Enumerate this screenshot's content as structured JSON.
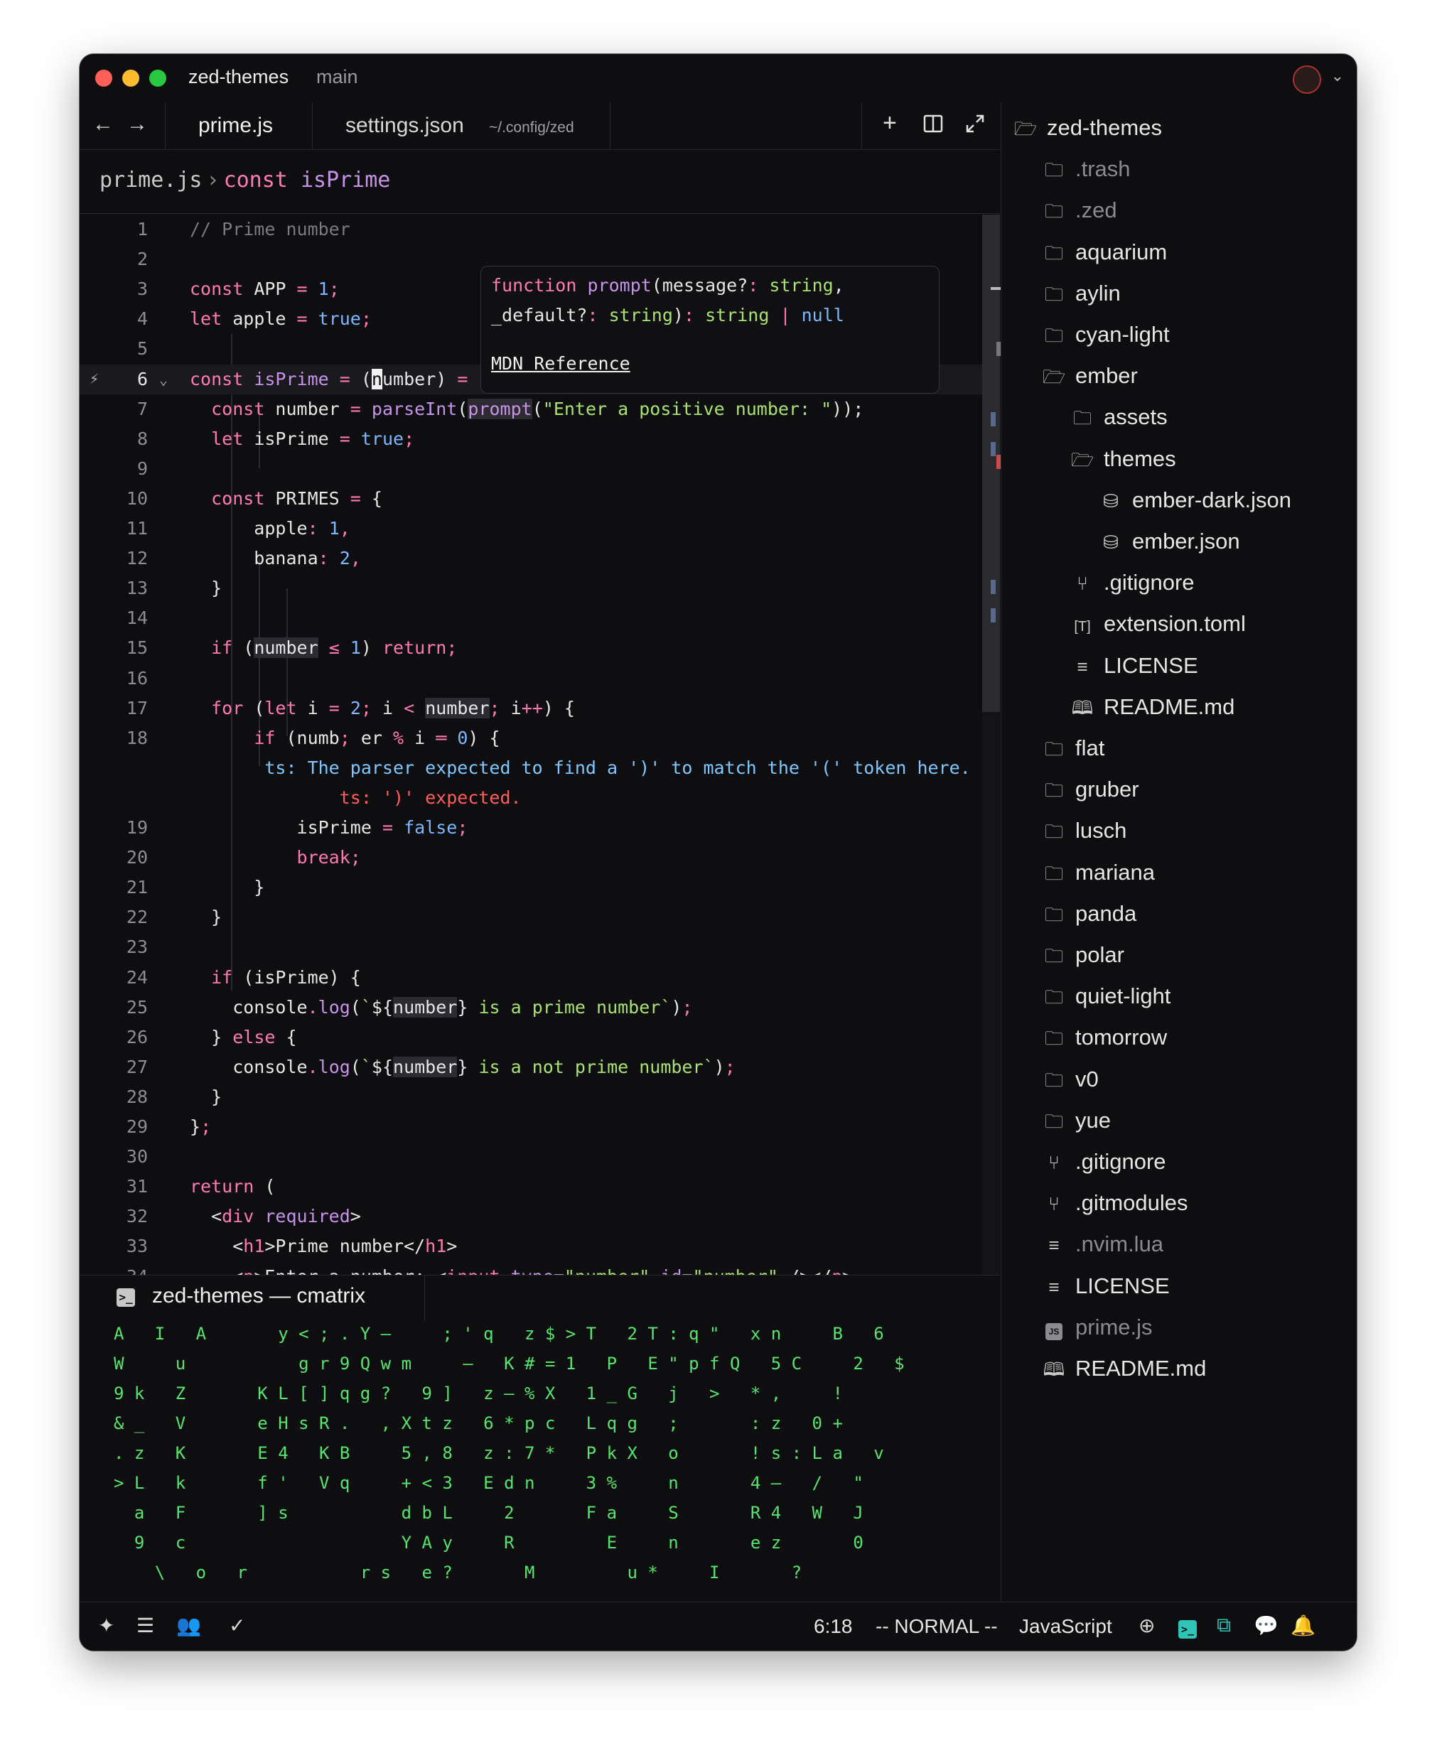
{
  "titlebar": {
    "project": "zed-themes",
    "branch": "main"
  },
  "tabs": {
    "active": "prime.js",
    "second": "settings.json",
    "second_path": "~/.config/zed"
  },
  "breadcrumb": {
    "file": "prime.js",
    "sep": "›",
    "symbol_kw": "const",
    "symbol": "isPrime"
  },
  "hover": {
    "line1": "function prompt(message?: string,",
    "line2": "_default?: string): string | null",
    "link": "MDN Reference"
  },
  "code_lines": [
    {
      "n": "1",
      "html": "<span class=\"c\">// Prime number</span>"
    },
    {
      "n": "2",
      "html": ""
    },
    {
      "n": "3",
      "html": "<span class=\"k\">const</span> APP <span class=\"o\">=</span> <span class=\"n\">1</span><span class=\"o\">;</span>"
    },
    {
      "n": "4",
      "html": "<span class=\"k\">let</span> apple <span class=\"o\">=</span> <span class=\"n\">true</span><span class=\"o\">;</span>"
    },
    {
      "n": "5",
      "html": ""
    },
    {
      "n": "6",
      "html": "<span class=\"k\">const</span> <span class=\"f\">isPrime</span> <span class=\"o\">=</span> (<span class=\"cursor\">n</span>umber) <span class=\"o\">=</span>"
    },
    {
      "n": "7",
      "html": "  <span class=\"k\">const</span> number <span class=\"o\">=</span> <span class=\"f\">parseInt</span>(<span class=\"f hl\">prompt</span>(<span class=\"s\">\"Enter a positive number: \"</span>));"
    },
    {
      "n": "8",
      "html": "  <span class=\"k\">let</span> isPrime <span class=\"o\">=</span> <span class=\"n\">true</span><span class=\"o\">;</span>"
    },
    {
      "n": "9",
      "html": ""
    },
    {
      "n": "10",
      "html": "  <span class=\"k\">const</span> PRIMES <span class=\"o\">=</span> {"
    },
    {
      "n": "11",
      "html": "      apple<span class=\"o\">:</span> <span class=\"n\">1</span><span class=\"o\">,</span>"
    },
    {
      "n": "12",
      "html": "      banana<span class=\"o\">:</span> <span class=\"n\">2</span><span class=\"o\">,</span>"
    },
    {
      "n": "13",
      "html": "  }"
    },
    {
      "n": "14",
      "html": ""
    },
    {
      "n": "15",
      "html": "  <span class=\"k\">if</span> (<span class=\"hl\">number</span> <span class=\"o\">≤</span> <span class=\"n\">1</span>) <span class=\"k\">return</span><span class=\"o\">;</span>"
    },
    {
      "n": "16",
      "html": ""
    },
    {
      "n": "17",
      "html": "  <span class=\"k\">for</span> (<span class=\"k\">let</span> i <span class=\"o\">=</span> <span class=\"n\">2</span><span class=\"o\">;</span> i <span class=\"o\">&lt;</span> <span class=\"hl\">number</span><span class=\"o\">;</span> i<span class=\"o\">++</span>) {"
    },
    {
      "n": "18",
      "html": "      <span class=\"k\">if</span> (numb<span class=\"o\">;</span> er <span class=\"o\">%</span> i <span class=\"o\">═</span> <span class=\"n\">0</span>) {"
    },
    {
      "n": "",
      "html": "       <span class=\"b\">ts: The parser expected to find a ')' to match the '(' token here.</span>"
    },
    {
      "n": "",
      "html": "              <span class=\"e\">ts: ')' expected.</span>"
    },
    {
      "n": "19",
      "html": "          isPrime <span class=\"o\">=</span> <span class=\"n\">false</span><span class=\"o\">;</span>"
    },
    {
      "n": "20",
      "html": "          <span class=\"k\">break</span><span class=\"o\">;</span>"
    },
    {
      "n": "21",
      "html": "      }"
    },
    {
      "n": "22",
      "html": "  }"
    },
    {
      "n": "23",
      "html": ""
    },
    {
      "n": "24",
      "html": "  <span class=\"k\">if</span> (isPrime) {"
    },
    {
      "n": "25",
      "html": "    console<span class=\"o\">.</span><span class=\"f\">log</span>(<span class=\"s\">`</span>${<span class=\"hl\">number</span>}<span class=\"s\"> is a prime number`</span>)<span class=\"o\">;</span>"
    },
    {
      "n": "26",
      "html": "  } <span class=\"k\">else</span> {"
    },
    {
      "n": "27",
      "html": "    console<span class=\"o\">.</span><span class=\"f\">log</span>(<span class=\"s\">`</span>${<span class=\"hl\">number</span>}<span class=\"s\"> is a not prime number`</span>)<span class=\"o\">;</span>"
    },
    {
      "n": "28",
      "html": "  }"
    },
    {
      "n": "29",
      "html": "}<span class=\"o\">;</span>"
    },
    {
      "n": "30",
      "html": ""
    },
    {
      "n": "31",
      "html": "<span class=\"k\">return</span> ("
    },
    {
      "n": "32",
      "html": "  &lt;<span class=\"k\">div</span> <span class=\"f\">required</span>&gt;"
    },
    {
      "n": "33",
      "html": "    &lt;<span class=\"k\">h1</span>&gt;Prime number&lt;/<span class=\"k\">h1</span>&gt;"
    },
    {
      "n": "34",
      "html": "    &lt;<span class=\"k\">p</span>&gt;Enter a number: &lt;<span class=\"k\">input</span> <span class=\"f\">type</span>=<span class=\"s\">\"number\"</span> <span class=\"f\">id</span>=<span class=\"s\">\"number\"</span> /&gt;&lt;/<span class=\"k\">p</span>&gt;"
    }
  ],
  "terminal": {
    "title": "zed-themes — cmatrix"
  },
  "matrix_lines": [
    "A   I   A       y < ; . Y –     ; ' q   z $ > T   2 T : q \"   x n     B   6",
    "W     u           g r 9 Q w m     –   K # = 1   P   E \" p f Q   5 C     2   $",
    "9 k   Z       K L [ ] q g ?   9 ]   z – % X   1 _ G   j   >   * ,     !",
    "& _   V       e H s R .   , X t z   6 * p c   L q g   ;       : z   0 +",
    ". z   K       E 4   K B     5 , 8   z : 7 *   P k X   o       ! s : L a   v",
    "> L   k       f '   V q     + < 3   E d n     3 %     n       4 –   /   \"",
    "  a   F       ] s           d b L     2       F a     S       R 4   W   J",
    "  9   c                     Y A y     R         E     n       e z       0",
    "    \\   o   r           r s   e ?       M         u *     I       ?"
  ],
  "tree": [
    {
      "label": "zed-themes",
      "icon": "folder-open-icon",
      "glyph": "🗁",
      "indent": 0,
      "dim": false
    },
    {
      "label": ".trash",
      "icon": "folder-icon",
      "glyph": "🗀",
      "indent": 1,
      "dim": true
    },
    {
      "label": ".zed",
      "icon": "folder-icon",
      "glyph": "🗀",
      "indent": 1,
      "dim": true
    },
    {
      "label": "aquarium",
      "icon": "folder-icon",
      "glyph": "🗀",
      "indent": 1,
      "dim": false
    },
    {
      "label": "aylin",
      "icon": "folder-icon",
      "glyph": "🗀",
      "indent": 1,
      "dim": false
    },
    {
      "label": "cyan-light",
      "icon": "folder-icon",
      "glyph": "🗀",
      "indent": 1,
      "dim": false
    },
    {
      "label": "ember",
      "icon": "folder-open-icon",
      "glyph": "🗁",
      "indent": 1,
      "dim": false
    },
    {
      "label": "assets",
      "icon": "folder-icon",
      "glyph": "🗀",
      "indent": 2,
      "dim": false
    },
    {
      "label": "themes",
      "icon": "folder-open-icon",
      "glyph": "🗁",
      "indent": 2,
      "dim": false
    },
    {
      "label": "ember-dark.json",
      "icon": "database-icon",
      "glyph": "⛁",
      "indent": 3,
      "dim": false
    },
    {
      "label": "ember.json",
      "icon": "database-icon",
      "glyph": "⛁",
      "indent": 3,
      "dim": false
    },
    {
      "label": ".gitignore",
      "icon": "git-branch-icon",
      "glyph": "⑂",
      "indent": 2,
      "dim": false
    },
    {
      "label": "extension.toml",
      "icon": "toml-icon",
      "glyph": "[T]",
      "indent": 2,
      "dim": false
    },
    {
      "label": "LICENSE",
      "icon": "lines-icon",
      "glyph": "≡",
      "indent": 2,
      "dim": false
    },
    {
      "label": "README.md",
      "icon": "book-icon",
      "glyph": "🕮",
      "indent": 2,
      "dim": false
    },
    {
      "label": "flat",
      "icon": "folder-icon",
      "glyph": "🗀",
      "indent": 1,
      "dim": false
    },
    {
      "label": "gruber",
      "icon": "folder-icon",
      "glyph": "🗀",
      "indent": 1,
      "dim": false
    },
    {
      "label": "lusch",
      "icon": "folder-icon",
      "glyph": "🗀",
      "indent": 1,
      "dim": false
    },
    {
      "label": "mariana",
      "icon": "folder-icon",
      "glyph": "🗀",
      "indent": 1,
      "dim": false
    },
    {
      "label": "panda",
      "icon": "folder-icon",
      "glyph": "🗀",
      "indent": 1,
      "dim": false
    },
    {
      "label": "polar",
      "icon": "folder-icon",
      "glyph": "🗀",
      "indent": 1,
      "dim": false
    },
    {
      "label": "quiet-light",
      "icon": "folder-icon",
      "glyph": "🗀",
      "indent": 1,
      "dim": false
    },
    {
      "label": "tomorrow",
      "icon": "folder-icon",
      "glyph": "🗀",
      "indent": 1,
      "dim": false
    },
    {
      "label": "v0",
      "icon": "folder-icon",
      "glyph": "🗀",
      "indent": 1,
      "dim": false
    },
    {
      "label": "yue",
      "icon": "folder-icon",
      "glyph": "🗀",
      "indent": 1,
      "dim": false
    },
    {
      "label": ".gitignore",
      "icon": "git-branch-icon",
      "glyph": "⑂",
      "indent": 1,
      "dim": false
    },
    {
      "label": ".gitmodules",
      "icon": "git-branch-icon",
      "glyph": "⑂",
      "indent": 1,
      "dim": false
    },
    {
      "label": ".nvim.lua",
      "icon": "lines-icon",
      "glyph": "≡",
      "indent": 1,
      "dim": true
    },
    {
      "label": "LICENSE",
      "icon": "lines-icon",
      "glyph": "≡",
      "indent": 1,
      "dim": false
    },
    {
      "label": "prime.js",
      "icon": "js-icon",
      "glyph": "JS",
      "indent": 1,
      "dim": true
    },
    {
      "label": "README.md",
      "icon": "book-icon",
      "glyph": "🕮",
      "indent": 1,
      "dim": false
    }
  ],
  "status": {
    "position": "6:18",
    "mode": "-- NORMAL --",
    "language": "JavaScript"
  },
  "colors": {
    "background": "#0e0e10",
    "keyword": "#ff7ab2",
    "function": "#c792ea",
    "string": "#a8e26f",
    "number": "#7cb7ff",
    "matrix": "#56e56b",
    "terminal_accent": "#2ec4b6"
  }
}
